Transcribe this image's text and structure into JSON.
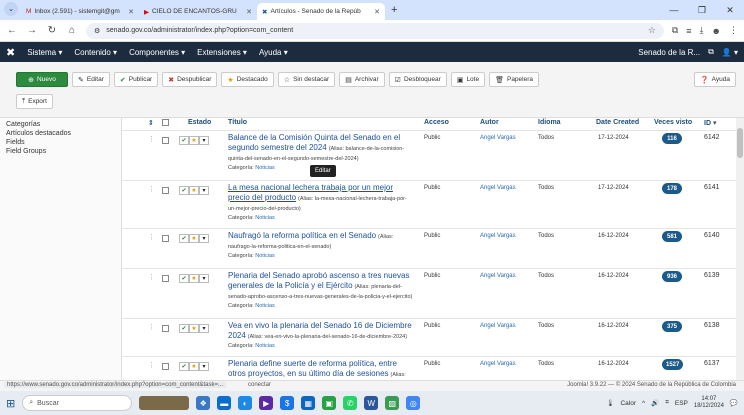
{
  "browser": {
    "tabs": [
      {
        "label": "Inbox (2.591) - sistemgit@gm",
        "active": false
      },
      {
        "label": "CIELO DE ENCANTOS-GRU",
        "active": false
      },
      {
        "label": "Artículos - Senado de la Repúb",
        "active": true
      }
    ],
    "url": "senado.gov.co/administrator/index.php?option=com_content"
  },
  "nav": {
    "logo": "✖",
    "items": [
      "Sistema ▾",
      "Contenido ▾",
      "Componentes ▾",
      "Extensiones ▾",
      "Ayuda ▾"
    ],
    "site": "Senado de la R...",
    "user": "👤 ▾"
  },
  "toolbar": {
    "new": "Nuevo",
    "edit": "Editar",
    "publish": "Publicar",
    "unpublish": "Despublicar",
    "feature": "Destacado",
    "unfeature": "Sin destacar",
    "archive": "Archivar",
    "checkin": "Desbloquear",
    "batch": "Lote",
    "trash": "Papelera",
    "help": "Ayuda",
    "export": "Export"
  },
  "sidebar": [
    "Categorías",
    "Artículos destacados",
    "Fields",
    "Field Groups"
  ],
  "table": {
    "headers": {
      "sort": "⇕",
      "status": "Estado",
      "title": "Título",
      "access": "Acceso",
      "author": "Autor",
      "language": "Idioma",
      "date": "Date Created",
      "hits": "Veces visto",
      "id": "ID ▾"
    },
    "category_label": "Categoría:",
    "rows": [
      {
        "title": "Balance de la Comisión Quinta del Senado en el segundo semestre del 2024",
        "alias": "(Alias: balance-de-la-comision-quinta-del-senado-en-el-segundo-semestre-del-2024)",
        "category": "Noticias",
        "access": "Public",
        "author": "Angel Vargas",
        "language": "Todos",
        "date": "17-12-2024",
        "hits": "116",
        "id": "6142"
      },
      {
        "title": "La mesa nacional lechera trabaja por un mejor precio del producto",
        "alias": "(Alias: la-mesa-nacional-lechera-trabaja-por-un-mejor-precio-del-producto)",
        "category": "Noticias",
        "access": "Public",
        "author": "Angel Vargas",
        "language": "Todos",
        "date": "17-12-2024",
        "hits": "178",
        "id": "6141"
      },
      {
        "title": "Naufragó la reforma política en el Senado",
        "alias": "(Alias: naufrago-la-reforma-politica-en-el-senado)",
        "category": "Noticias",
        "access": "Public",
        "author": "Angel Vargas",
        "language": "Todos",
        "date": "16-12-2024",
        "hits": "581",
        "id": "6140"
      },
      {
        "title": "Plenaria del Senado aprobó ascenso a tres nuevas generales de la Policía y el Ejército",
        "alias": "(Alias: plenaria-del-senado-aprobo-ascenso-a-tres-nuevas-generales-de-la-policia-y-el-ejercito)",
        "category": "Noticias",
        "access": "Public",
        "author": "Angel Vargas",
        "language": "Todos",
        "date": "16-12-2024",
        "hits": "936",
        "id": "6139"
      },
      {
        "title": "Vea en vivo la plenaria del Senado 16 de Diciembre 2024",
        "alias": "(Alias: vea-en-vivo-la-plenaria-del-senado-16-de-diciembre-2024)",
        "category": "Noticias",
        "access": "Public",
        "author": "Angel Vargas",
        "language": "Todos",
        "date": "16-12-2024",
        "hits": "375",
        "id": "6138"
      },
      {
        "title": "Plenaria define suerte de reforma política, entre otros proyectos, en su último día de sesiones",
        "alias": "(Alias: plenaria-define-suerte",
        "category": "",
        "access": "Public",
        "author": "Angel Vargas",
        "language": "Todos",
        "date": "16-12-2024",
        "hits": "1527",
        "id": "6137"
      }
    ],
    "tooltip": "Editar"
  },
  "status_bar": {
    "url": "https://www.senado.gov.co/administrator/index.php?option=com_content&task=...",
    "conn": "conectar",
    "footer": "Joomla! 3.9.22 — © 2024 Senado de la República de Colombia"
  },
  "taskbar": {
    "search": "Buscar",
    "weather": "Calor",
    "lang": "ESP",
    "time": "14:07",
    "date": "18/12/2024"
  }
}
